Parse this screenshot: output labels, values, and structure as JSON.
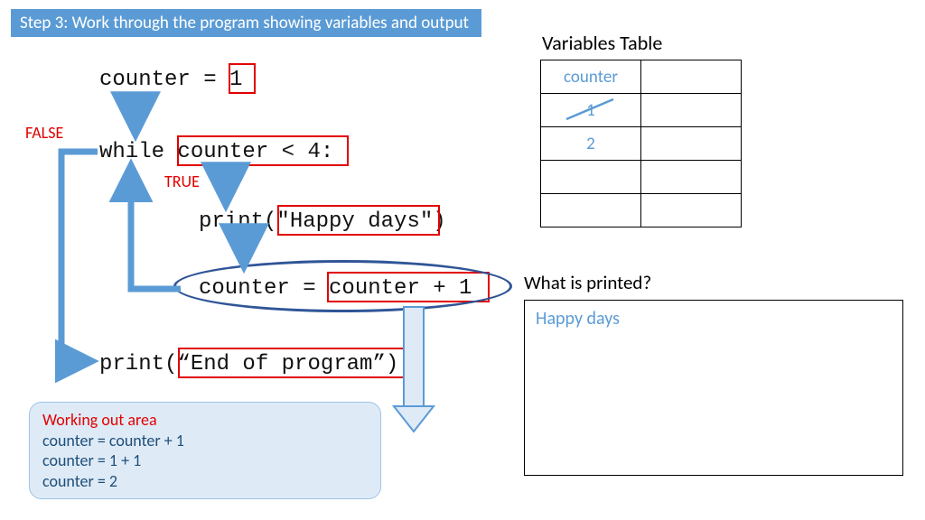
{
  "banner": "Step 3: Work through the program showing variables and output",
  "code": {
    "line1": "counter = 1",
    "line2": "while counter < 4:",
    "line3": "print(\"Happy days\")",
    "line4": "counter = counter + 1",
    "line5": "print(“End of program”)"
  },
  "labels": {
    "false": "FALSE",
    "true": "TRUE"
  },
  "variables": {
    "title": "Variables Table",
    "rows": [
      [
        "counter",
        ""
      ],
      [
        "1",
        ""
      ],
      [
        "2",
        ""
      ],
      [
        "",
        ""
      ],
      [
        "",
        ""
      ]
    ],
    "struck_row_index": 1
  },
  "printed": {
    "title": "What is printed?",
    "lines": [
      "Happy days"
    ]
  },
  "workout": {
    "title": "Working out area",
    "lines": [
      "counter = counter + 1",
      "counter = 1 + 1",
      "counter = 2"
    ]
  }
}
